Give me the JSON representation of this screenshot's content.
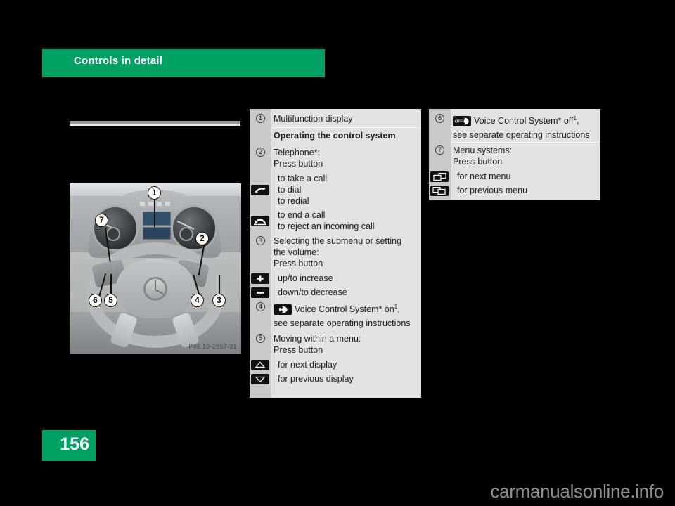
{
  "header": {
    "title": "Controls in detail"
  },
  "page": {
    "number": "156",
    "watermark": "carmanualsonline.info"
  },
  "figure": {
    "caption": "P46.10-2867-31",
    "callouts": [
      "1",
      "2",
      "3",
      "4",
      "5",
      "6",
      "7"
    ]
  },
  "panels": {
    "middle": {
      "rows": [
        {
          "num": "1",
          "text": "Multifunction display"
        },
        {
          "num": "",
          "text": "Operating the control system",
          "bold": true
        },
        {
          "num": "2",
          "lines": [
            "Telephone*:",
            "Press button"
          ]
        },
        {
          "icon": "phone-receiver-lifted-icon",
          "lines": [
            "to take a call",
            "to dial",
            "to redial"
          ]
        },
        {
          "icon": "phone-receiver-down-icon",
          "lines": [
            "to end a call",
            "to reject an incoming call"
          ]
        },
        {
          "num": "3",
          "lines": [
            "Selecting the submenu or setting",
            "the volume:",
            "Press button"
          ]
        },
        {
          "icon": "plus-icon",
          "lines": [
            "up/to increase"
          ]
        },
        {
          "icon": "minus-icon",
          "lines": [
            "down/to decrease"
          ]
        },
        {
          "num": "4",
          "icon_inline": "voice-control-on-icon",
          "lines": [
            "Voice Control System* on",
            "see separate operating instructions"
          ],
          "sup": "1",
          "sup_tail": ","
        },
        {
          "num": "5",
          "lines": [
            "Moving within a menu:",
            "Press button"
          ]
        },
        {
          "icon": "arrow-up-icon",
          "lines": [
            "for next display"
          ]
        },
        {
          "icon": "arrow-down-icon",
          "lines": [
            "for previous display"
          ]
        }
      ]
    },
    "right": {
      "rows": [
        {
          "num": "6",
          "icon_inline": "voice-control-off-icon",
          "lines": [
            "Voice Control System* off",
            "see separate operating instructions"
          ],
          "sup": "1",
          "sup_tail": ","
        },
        {
          "num": "7",
          "lines": [
            "Menu systems:",
            "Press button"
          ]
        },
        {
          "icon": "next-menu-icon",
          "lines": [
            "for next menu"
          ]
        },
        {
          "icon": "previous-menu-icon",
          "lines": [
            "for previous menu"
          ]
        }
      ]
    }
  },
  "colors": {
    "brand_green": "#00a063",
    "panel_bg": "#e2e2e2",
    "panel_gutter": "#c9c9c9",
    "icon_black": "#111111",
    "page_bg": "#000000"
  }
}
